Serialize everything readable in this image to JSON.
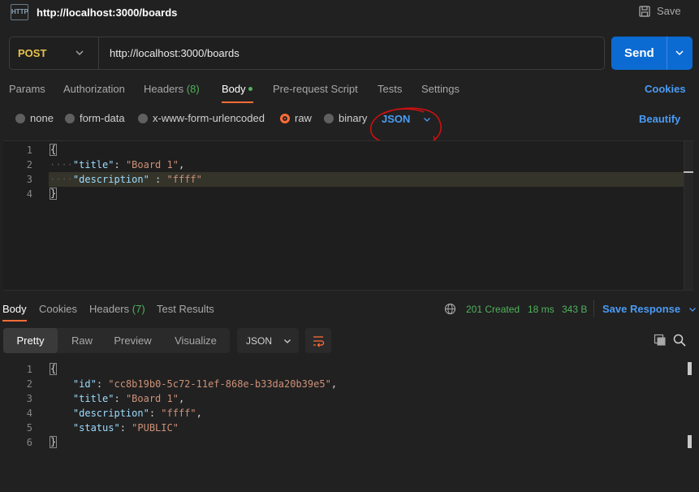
{
  "header": {
    "icon_text": "HTTP",
    "title": "http://localhost:3000/boards",
    "save_label": "Save"
  },
  "request": {
    "method": "POST",
    "url": "http://localhost:3000/boards",
    "send_label": "Send"
  },
  "tabs": {
    "params": "Params",
    "authorization": "Authorization",
    "headers": "Headers",
    "headers_count": "(8)",
    "body": "Body",
    "pre_request": "Pre-request Script",
    "tests": "Tests",
    "settings": "Settings",
    "cookies": "Cookies"
  },
  "body_options": {
    "none": "none",
    "form_data": "form-data",
    "urlencoded": "x-www-form-urlencoded",
    "raw": "raw",
    "binary": "binary",
    "format": "JSON",
    "beautify": "Beautify"
  },
  "request_body": {
    "line_numbers": [
      "1",
      "2",
      "3",
      "4"
    ],
    "open_brace": "{",
    "close_brace": "}",
    "title_key": "\"title\"",
    "title_val": "\"Board 1\"",
    "desc_key": "\"description\"",
    "desc_val": "\"ffff\""
  },
  "response_tabs": {
    "body": "Body",
    "cookies": "Cookies",
    "headers": "Headers",
    "headers_count": "(7)",
    "test_results": "Test Results"
  },
  "response_status": {
    "status": "201 Created",
    "time": "18 ms",
    "size": "343 B",
    "save_response": "Save Response"
  },
  "view_modes": {
    "pretty": "Pretty",
    "raw": "Raw",
    "preview": "Preview",
    "visualize": "Visualize",
    "format": "JSON"
  },
  "response_body": {
    "line_numbers": [
      "1",
      "2",
      "3",
      "4",
      "5",
      "6"
    ],
    "open_brace": "{",
    "close_brace": "}",
    "id_key": "\"id\"",
    "id_val": "\"cc8b19b0-5c72-11ef-868e-b33da20b39e5\"",
    "title_key": "\"title\"",
    "title_val": "\"Board 1\"",
    "desc_key": "\"description\"",
    "desc_val": "\"ffff\"",
    "status_key": "\"status\"",
    "status_val": "\"PUBLIC\""
  },
  "colors": {
    "accent_orange": "#ff6c37",
    "link_blue": "#4a9cf5",
    "send_blue": "#0b6bd3",
    "success_green": "#4fb35b",
    "method_yellow": "#e8c24a",
    "annotation_red": "#cc1111"
  }
}
